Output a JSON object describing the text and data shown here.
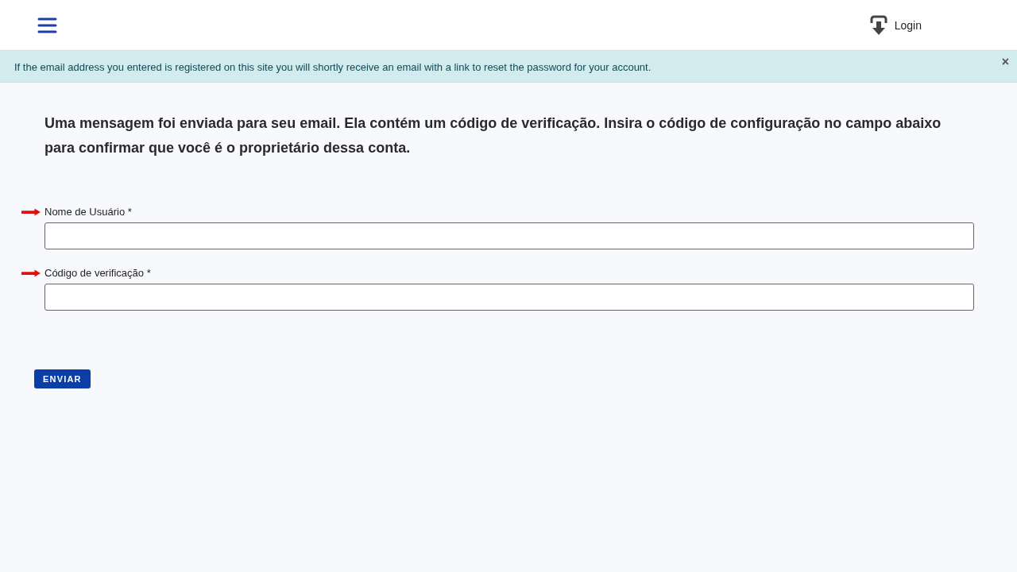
{
  "header": {
    "login_label": "Login"
  },
  "alert": {
    "message": "If the email address you entered is registered on this site you will shortly receive an email with a link to reset the password for your account.",
    "close": "×"
  },
  "instructions": "Uma mensagem foi enviada para seu email. Ela contém um código de verificação. Insira o código de configuração no campo abaixo para confirmar que você é o proprietário dessa conta.",
  "fields": [
    {
      "label": "Nome de Usuário *"
    },
    {
      "label": "Código de verificação *"
    }
  ],
  "submit_button": "ENVIAR"
}
